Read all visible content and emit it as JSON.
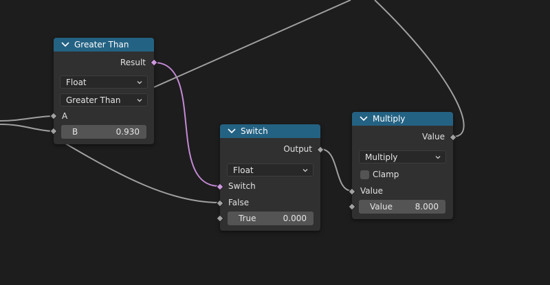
{
  "nodes": {
    "greater_than": {
      "title": "Greater Than",
      "output_label": "Result",
      "type_dropdown": "Float",
      "operation_dropdown": "Greater Than",
      "input_a_label": "A",
      "input_b_label": "B",
      "input_b_value": "0.930"
    },
    "switch": {
      "title": "Switch",
      "output_label": "Output",
      "type_dropdown": "Float",
      "switch_label": "Switch",
      "false_label": "False",
      "true_label": "True",
      "true_value": "0.000"
    },
    "multiply": {
      "title": "Multiply",
      "output_label": "Value",
      "operation_dropdown": "Multiply",
      "clamp_label": "Clamp",
      "clamp_checked": false,
      "input_value_label": "Value",
      "value_field_label": "Value",
      "value_field_value": "8.000"
    }
  },
  "colors": {
    "background": "#1d1d1d",
    "node_body": "#303030",
    "node_header": "#246283",
    "wire_float": "#a1a1a1",
    "wire_bool": "#c58ad6",
    "socket_float": "#a1a1a1",
    "socket_bool": "#cc99e0"
  }
}
